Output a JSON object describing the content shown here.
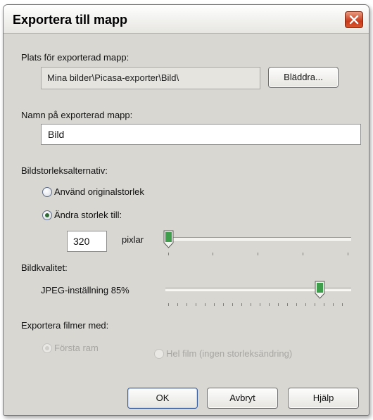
{
  "dialog": {
    "title": "Exportera till mapp",
    "close_icon": "close-icon"
  },
  "location": {
    "label": "Plats för exporterad mapp:",
    "path": "Mina bilder\\Picasa-exporter\\Bild\\",
    "browse_button": "Bläddra..."
  },
  "folder_name": {
    "label": "Namn på exporterad mapp:",
    "value": "Bild"
  },
  "image_size": {
    "label": "Bildstorleksalternativ:",
    "option_original": "Använd originalstorlek",
    "option_resize": "Ändra storlek till:",
    "selected": "resize",
    "size_value": "320",
    "unit": "pixlar",
    "slider_level": 0.0
  },
  "quality": {
    "label": "Bildkvalitet:",
    "setting_text": "JPEG-inställning 85%",
    "slider_level": 0.85
  },
  "movies": {
    "label": "Exportera filmer med:",
    "option_first_frame": "Första ram",
    "option_whole_film": "Hel film (ingen storleksändring)",
    "selected": "first_frame",
    "enabled": false
  },
  "buttons": {
    "ok": "OK",
    "cancel": "Avbryt",
    "help": "Hjälp"
  },
  "colors": {
    "close_button": "#c73a1a",
    "slider_thumb": "#2f8a3a",
    "dialog_background": "#d9d7d2"
  }
}
